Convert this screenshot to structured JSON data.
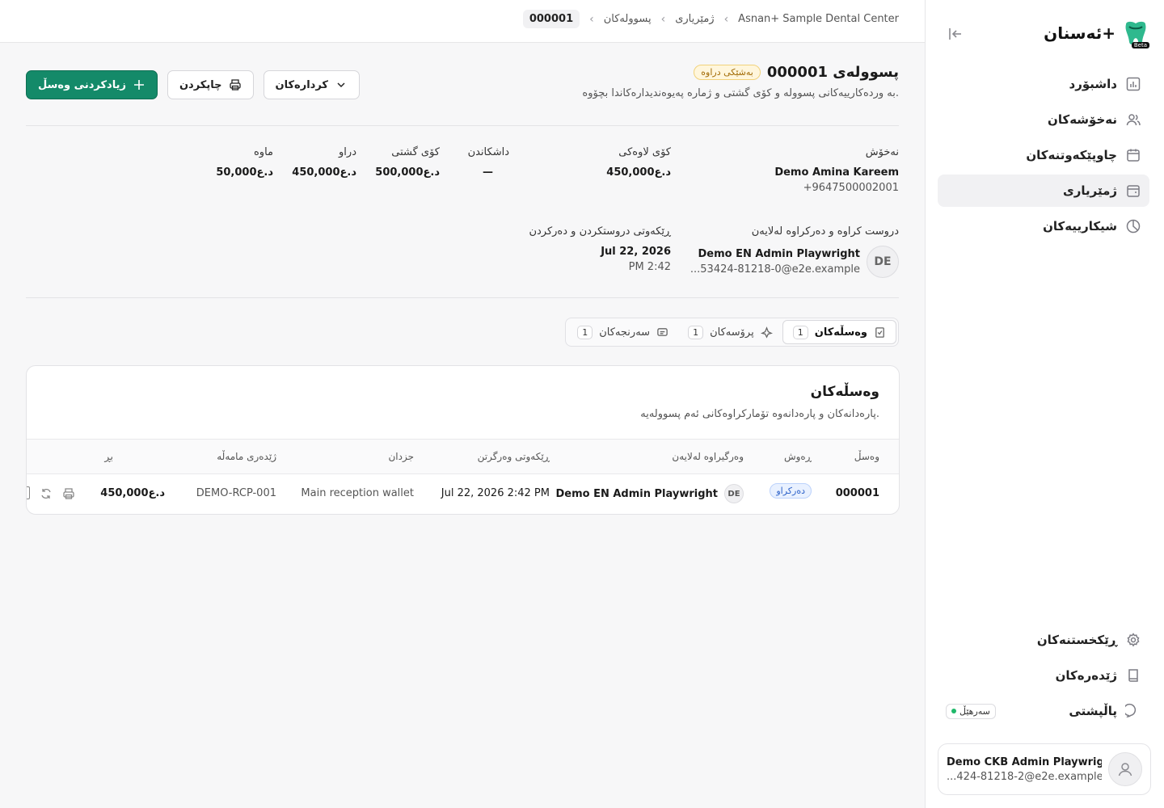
{
  "sidebar": {
    "brand": "ئەسنان+",
    "beta": "Beta",
    "nav": [
      {
        "label": "داشبۆرد",
        "icon": "chart-icon"
      },
      {
        "label": "نەخۆشەکان",
        "icon": "users-icon"
      },
      {
        "label": "چاوپێکەوتنەکان",
        "icon": "calendar-icon"
      },
      {
        "label": "ژمێریاری",
        "icon": "wallet-icon",
        "active": true
      },
      {
        "label": "شیکارییەکان",
        "icon": "pie-icon"
      }
    ],
    "bottom": [
      {
        "label": "ڕێکخستنەکان",
        "icon": "gear-icon"
      },
      {
        "label": "ژێدەرەکان",
        "icon": "book-icon"
      },
      {
        "label": "پاڵپشتی",
        "icon": "chat-icon",
        "status": "سەرهێڵ"
      }
    ],
    "user": {
      "name": "Demo CKB Admin Playwright",
      "email": "...424-81218-2@e2e.example"
    }
  },
  "breadcrumb": [
    "Asnan+ Sample Dental Center",
    "ژمێریاری",
    "پسوولەکان",
    "000001"
  ],
  "header": {
    "title": "پسوولەی 000001",
    "status": "بەشێکی دراوە",
    "subtitle": "بە وردەکارییەکانی پسوولە و کۆی گشتی و ژمارە پەیوەندیدارەکاندا بچۆوە.",
    "actions_label": "کردارەکان",
    "print_label": "چاپکردن",
    "add_label": "زیادکردنی وەسڵ"
  },
  "summary": {
    "patient_label": "نەخۆش",
    "patient_name": "Demo Amina Kareem",
    "patient_phone": "+9647500002001",
    "subtotal_label": "کۆی لاوەکی",
    "subtotal": "450,000د.ع",
    "discount_label": "داشکاندن",
    "discount": "—",
    "total_label": "کۆی گشتی",
    "total": "500,000د.ع",
    "paid_label": "دراو",
    "paid": "450,000د.ع",
    "remaining_label": "ماوە",
    "remaining": "50,000د.ع",
    "created_by_label": "دروست کراوە و دەرکراوە لەلایەن",
    "created_by_initials": "DE",
    "created_by_name": "Demo EN Admin Playwright",
    "created_by_email": "...53424-81218-0@e2e.example",
    "created_at_label": "ڕێکەوتی دروستکردن و دەرکردن",
    "created_date": "Jul 22, 2026",
    "created_time": "PM 2:42"
  },
  "tabs": [
    {
      "label": "وەسڵەکان",
      "count": "1",
      "active": true
    },
    {
      "label": "پرۆسەکان",
      "count": "1"
    },
    {
      "label": "سەرنجەکان",
      "count": "1"
    }
  ],
  "receipts": {
    "title": "وەسڵەکان",
    "subtitle": "پارەدانەکان و پارەدانەوە تۆمارکراوەکانی ئەم پسوولەیە.",
    "columns": [
      "وەسڵ",
      "ڕەوش",
      "وەرگیراوە لەلایەن",
      "ڕێکەوتی وەرگرتن",
      "جزدان",
      "ژێدەری مامەڵە",
      "بڕ"
    ],
    "rows": [
      {
        "receipt": "000001",
        "status": "دەرکراو",
        "initials": "DE",
        "received_by": "Demo EN Admin Playwright",
        "date": "Jul 22, 2026 2:42 PM",
        "wallet": "Main reception wallet",
        "reference": "DEMO-RCP-001",
        "amount": "450,000د.ع"
      }
    ]
  },
  "colors": {
    "primary": "#148a69",
    "badge_warning": "#fff6dc",
    "badge_info": "#e9f1ff"
  }
}
